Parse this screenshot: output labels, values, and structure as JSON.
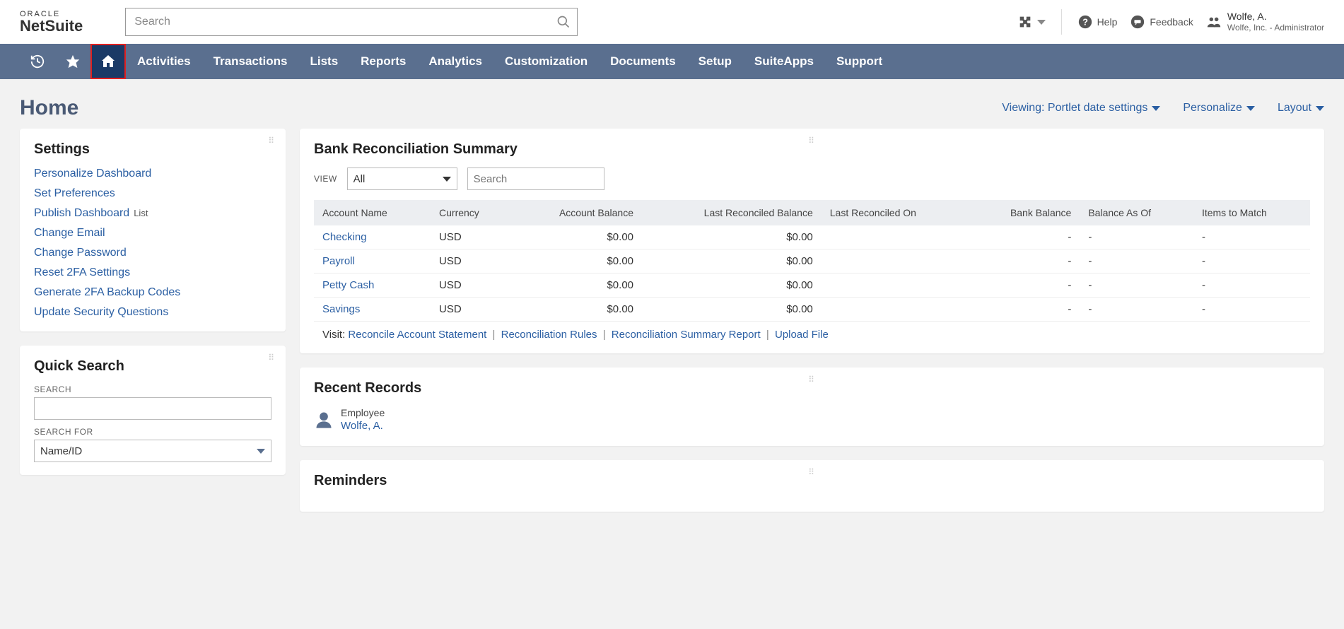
{
  "header": {
    "logo_top": "ORACLE",
    "logo_bottom": "NetSuite",
    "search_placeholder": "Search",
    "help": "Help",
    "feedback": "Feedback",
    "user_name": "Wolfe, A.",
    "user_role": "Wolfe, Inc. - Administrator"
  },
  "nav": {
    "items": [
      "Activities",
      "Transactions",
      "Lists",
      "Reports",
      "Analytics",
      "Customization",
      "Documents",
      "Setup",
      "SuiteApps",
      "Support"
    ]
  },
  "page": {
    "title": "Home",
    "viewing": "Viewing: Portlet date settings",
    "personalize": "Personalize",
    "layout": "Layout"
  },
  "settings": {
    "title": "Settings",
    "items": [
      {
        "label": "Personalize Dashboard"
      },
      {
        "label": "Set Preferences"
      },
      {
        "label": "Publish Dashboard",
        "tag": "List"
      },
      {
        "label": "Change Email"
      },
      {
        "label": "Change Password"
      },
      {
        "label": "Reset 2FA Settings"
      },
      {
        "label": "Generate 2FA Backup Codes"
      },
      {
        "label": "Update Security Questions"
      }
    ]
  },
  "quicksearch": {
    "title": "Quick Search",
    "search_label": "SEARCH",
    "search_for_label": "SEARCH FOR",
    "search_for_value": "Name/ID"
  },
  "recon": {
    "title": "Bank Reconciliation Summary",
    "view_label": "VIEW",
    "view_value": "All",
    "search_placeholder": "Search",
    "columns": [
      "Account Name",
      "Currency",
      "Account Balance",
      "Last Reconciled Balance",
      "Last Reconciled On",
      "Bank Balance",
      "Balance As Of",
      "Items to Match"
    ],
    "rows": [
      {
        "name": "Checking",
        "currency": "USD",
        "balance": "$0.00",
        "last_bal": "$0.00",
        "last_on": "",
        "bank_bal": "-",
        "as_of": "-",
        "items": "-"
      },
      {
        "name": "Payroll",
        "currency": "USD",
        "balance": "$0.00",
        "last_bal": "$0.00",
        "last_on": "",
        "bank_bal": "-",
        "as_of": "-",
        "items": "-"
      },
      {
        "name": "Petty Cash",
        "currency": "USD",
        "balance": "$0.00",
        "last_bal": "$0.00",
        "last_on": "",
        "bank_bal": "-",
        "as_of": "-",
        "items": "-"
      },
      {
        "name": "Savings",
        "currency": "USD",
        "balance": "$0.00",
        "last_bal": "$0.00",
        "last_on": "",
        "bank_bal": "-",
        "as_of": "-",
        "items": "-"
      }
    ],
    "visit_label": "Visit:",
    "visit_links": [
      "Reconcile Account Statement",
      "Reconciliation Rules",
      "Reconciliation Summary Report",
      "Upload File"
    ]
  },
  "recent": {
    "title": "Recent Records",
    "type": "Employee",
    "name": "Wolfe, A."
  },
  "reminders": {
    "title": "Reminders"
  }
}
